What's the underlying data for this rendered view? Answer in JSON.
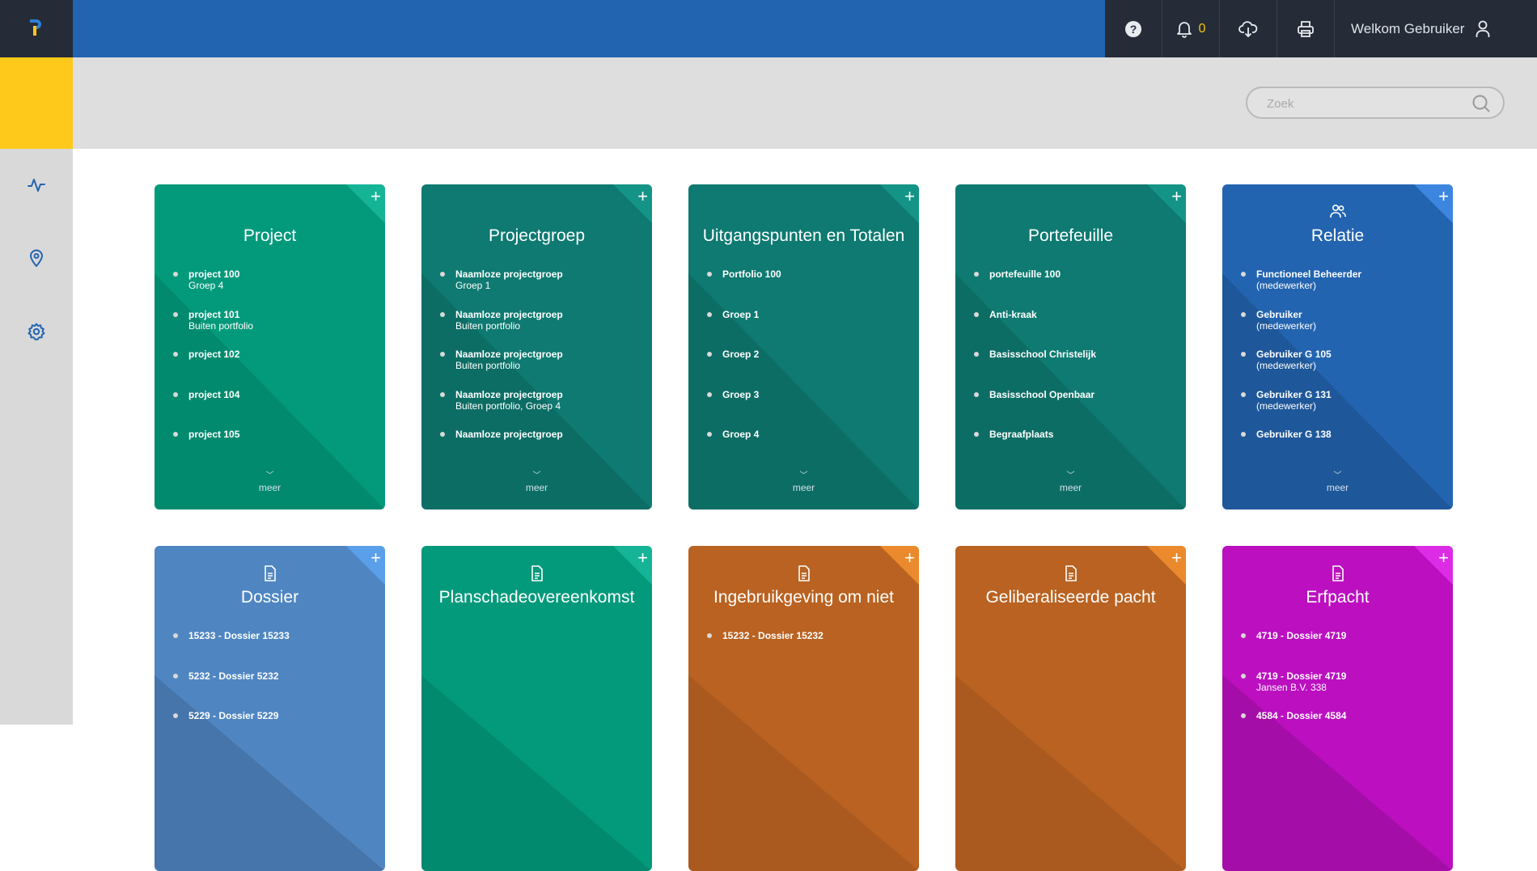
{
  "topbar": {
    "notification_count": "0",
    "welcome_text": "Welkom Gebruiker",
    "icons": [
      "logo-icon",
      "help-icon",
      "bell-icon",
      "cloud-download-icon",
      "printer-icon",
      "user-icon"
    ]
  },
  "sidebar": {
    "items": [
      {
        "name": "activity-icon"
      },
      {
        "name": "location-pin-icon"
      },
      {
        "name": "settings-gear-icon"
      }
    ]
  },
  "search": {
    "placeholder": "Zoek"
  },
  "more_label": "meer",
  "colors": {
    "topbar": "#2364b0",
    "dark": "#262c37",
    "accent_yellow": "#fec91a",
    "card_green": "#039a7b",
    "card_teal": "#0e7a71",
    "card_blue": "#2364b0",
    "card_steel": "#4f86c2",
    "card_orange": "#b96221",
    "card_magenta": "#bb0fc0"
  },
  "cards": [
    {
      "title": "Project",
      "icon": "",
      "items": [
        {
          "label": "project 100",
          "sub": "Groep 4"
        },
        {
          "label": "project 101",
          "sub": "Buiten portfolio"
        },
        {
          "label": "project 102",
          "sub": ""
        },
        {
          "label": "project 104",
          "sub": ""
        },
        {
          "label": "project 105",
          "sub": ""
        }
      ]
    },
    {
      "title": "Projectgroep",
      "icon": "",
      "items": [
        {
          "label": "Naamloze projectgroep",
          "sub": "Groep 1"
        },
        {
          "label": "Naamloze projectgroep",
          "sub": "Buiten portfolio"
        },
        {
          "label": "Naamloze projectgroep",
          "sub": "Buiten portfolio"
        },
        {
          "label": "Naamloze projectgroep",
          "sub": "Buiten portfolio, Groep 4"
        },
        {
          "label": "Naamloze projectgroep",
          "sub": ""
        }
      ]
    },
    {
      "title": "Uitgangspunten en Totalen",
      "icon": "",
      "items": [
        {
          "label": "Portfolio 100",
          "sub": ""
        },
        {
          "label": "Groep 1",
          "sub": ""
        },
        {
          "label": "Groep 2",
          "sub": ""
        },
        {
          "label": "Groep 3",
          "sub": ""
        },
        {
          "label": "Groep 4",
          "sub": ""
        }
      ]
    },
    {
      "title": "Portefeuille",
      "icon": "",
      "items": [
        {
          "label": "portefeuille 100",
          "sub": ""
        },
        {
          "label": "Anti-kraak",
          "sub": ""
        },
        {
          "label": "Basisschool Christelijk",
          "sub": ""
        },
        {
          "label": "Basisschool Openbaar",
          "sub": ""
        },
        {
          "label": "Begraafplaats",
          "sub": ""
        }
      ]
    },
    {
      "title": "Relatie",
      "icon": "users-icon",
      "items": [
        {
          "label": "Functioneel Beheerder",
          "sub": "(medewerker)"
        },
        {
          "label": "Gebruiker",
          "sub": "(medewerker)"
        },
        {
          "label": "Gebruiker G 105",
          "sub": "(medewerker)"
        },
        {
          "label": "Gebruiker G 131",
          "sub": "(medewerker)"
        },
        {
          "label": "Gebruiker G 138",
          "sub": ""
        }
      ]
    },
    {
      "title": "Dossier",
      "icon": "document-icon",
      "items": [
        {
          "label": "15233 - Dossier 15233",
          "sub": ""
        },
        {
          "label": "5232 - Dossier 5232",
          "sub": ""
        },
        {
          "label": "5229 - Dossier 5229",
          "sub": ""
        }
      ]
    },
    {
      "title": "Planschadeovereenkomst",
      "icon": "document-icon",
      "items": []
    },
    {
      "title": "Ingebruikgeving om niet",
      "icon": "document-icon",
      "items": [
        {
          "label": "15232 - Dossier 15232",
          "sub": ""
        }
      ]
    },
    {
      "title": "Geliberaliseerde pacht",
      "icon": "document-icon",
      "items": []
    },
    {
      "title": "Erfpacht",
      "icon": "document-icon",
      "items": [
        {
          "label": "4719 - Dossier 4719",
          "sub": ""
        },
        {
          "label": "4719 - Dossier 4719",
          "sub": "Jansen B.V. 338"
        },
        {
          "label": "4584 - Dossier 4584",
          "sub": ""
        }
      ]
    }
  ]
}
